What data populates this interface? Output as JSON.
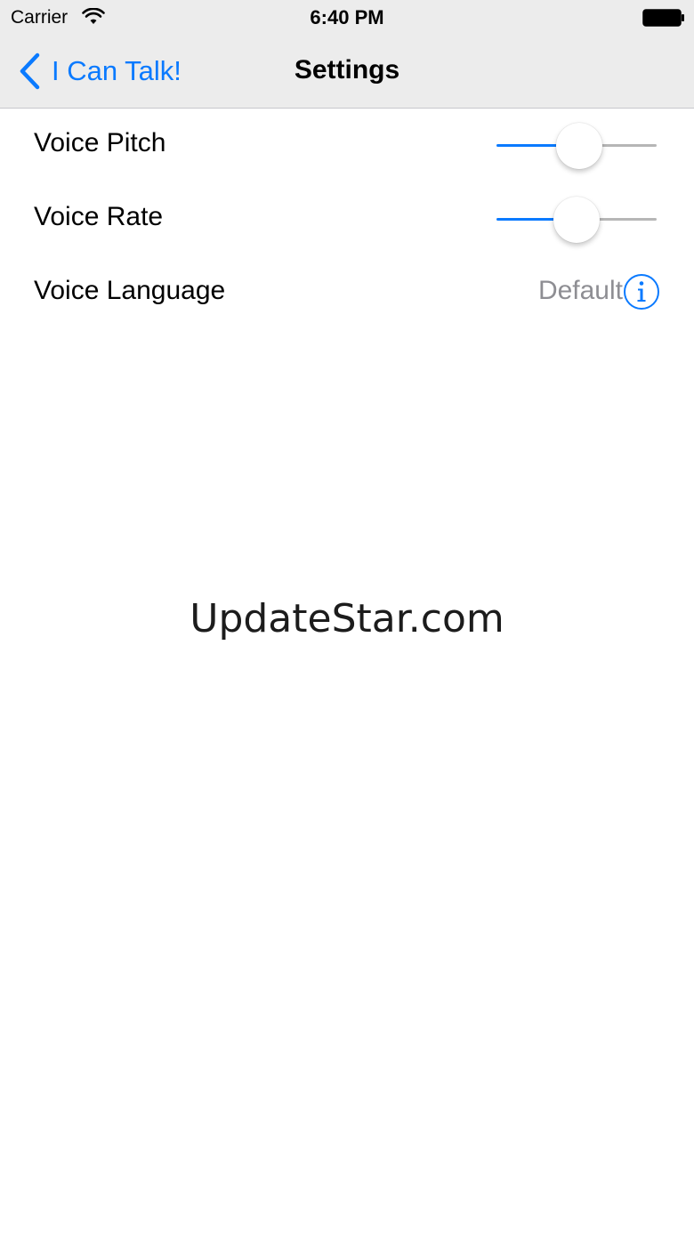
{
  "status_bar": {
    "carrier": "Carrier",
    "time": "6:40 PM",
    "wifi_icon": "wifi-icon",
    "battery_icon": "battery-full-icon"
  },
  "nav": {
    "back_label": "I Can Talk!",
    "back_icon": "chevron-left-icon",
    "title": "Settings"
  },
  "settings": {
    "voice_pitch": {
      "label": "Voice Pitch",
      "value": 0.52
    },
    "voice_rate": {
      "label": "Voice Rate",
      "value": 0.5
    },
    "voice_language": {
      "label": "Voice Language",
      "value": "Default",
      "icon": "info-icon"
    }
  },
  "watermark": "UpdateStar.com",
  "colors": {
    "accent": "#0a7aff",
    "header_bg": "#ececec",
    "secondary_text": "#8e8e93",
    "track_inactive": "#b6b6b6"
  }
}
